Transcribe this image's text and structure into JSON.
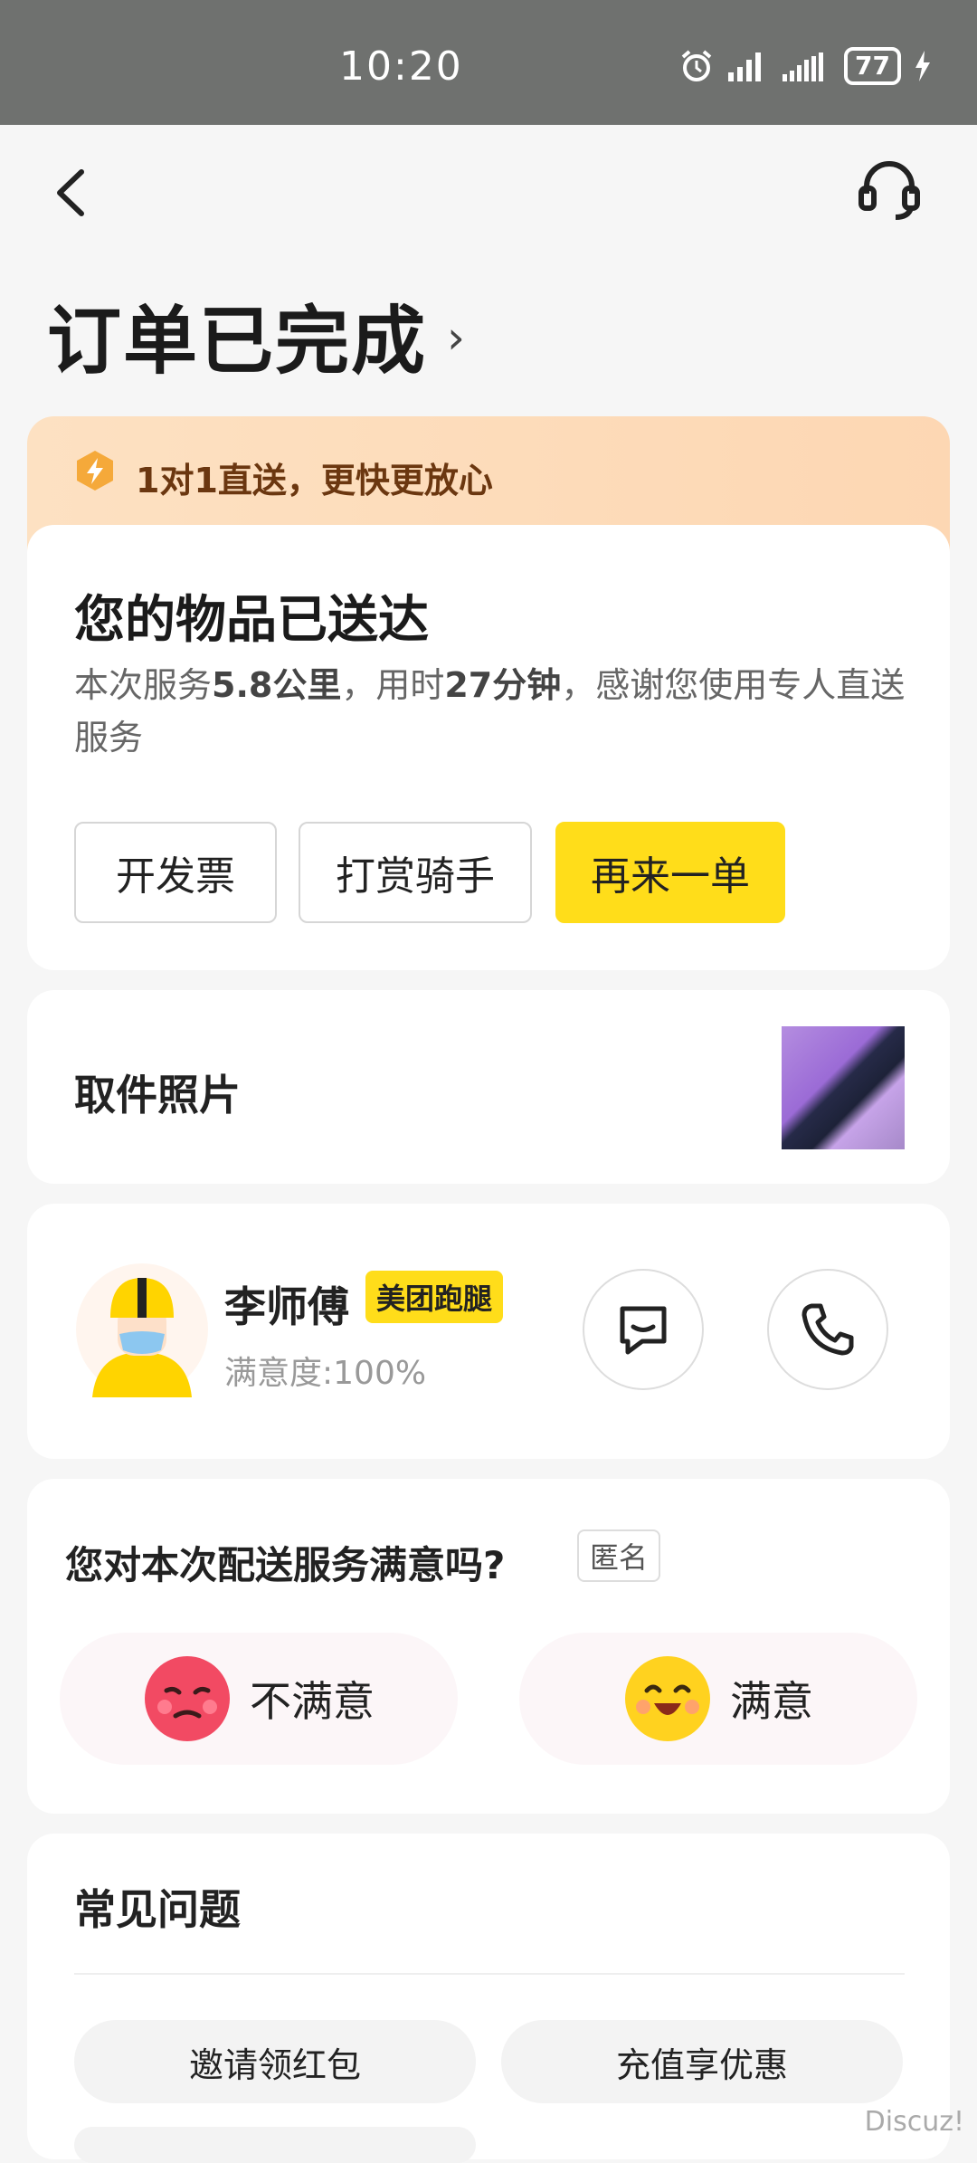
{
  "status_bar": {
    "time": "10:20",
    "battery": "77"
  },
  "header": {
    "title": "订单已完成",
    "chevron": "›"
  },
  "banner": {
    "text": "1对1直送，更快更放心"
  },
  "delivered": {
    "title": "您的物品已送达",
    "desc_prefix": "本次服务",
    "distance": "5.8公里",
    "desc_mid": "，用时",
    "duration": "27分钟",
    "desc_suffix": "，感谢您使用专人直送服务",
    "buttons": {
      "invoice": "开发票",
      "tip": "打赏骑手",
      "again": "再来一单"
    }
  },
  "pickup_photo": {
    "label": "取件照片"
  },
  "rider": {
    "name": "李师傅",
    "badge": "美团跑腿",
    "rating": "满意度:100%"
  },
  "rating": {
    "question": "您对本次配送服务满意吗?",
    "anonymous": "匿名",
    "unsatisfied": "不满意",
    "satisfied": "满意"
  },
  "faq": {
    "title": "常见问题",
    "chips": [
      "邀请领红包",
      "充值享优惠"
    ]
  },
  "watermark": "Discuz!",
  "colors": {
    "accent": "#ffdd1a",
    "banner": "#fdd9b5"
  }
}
